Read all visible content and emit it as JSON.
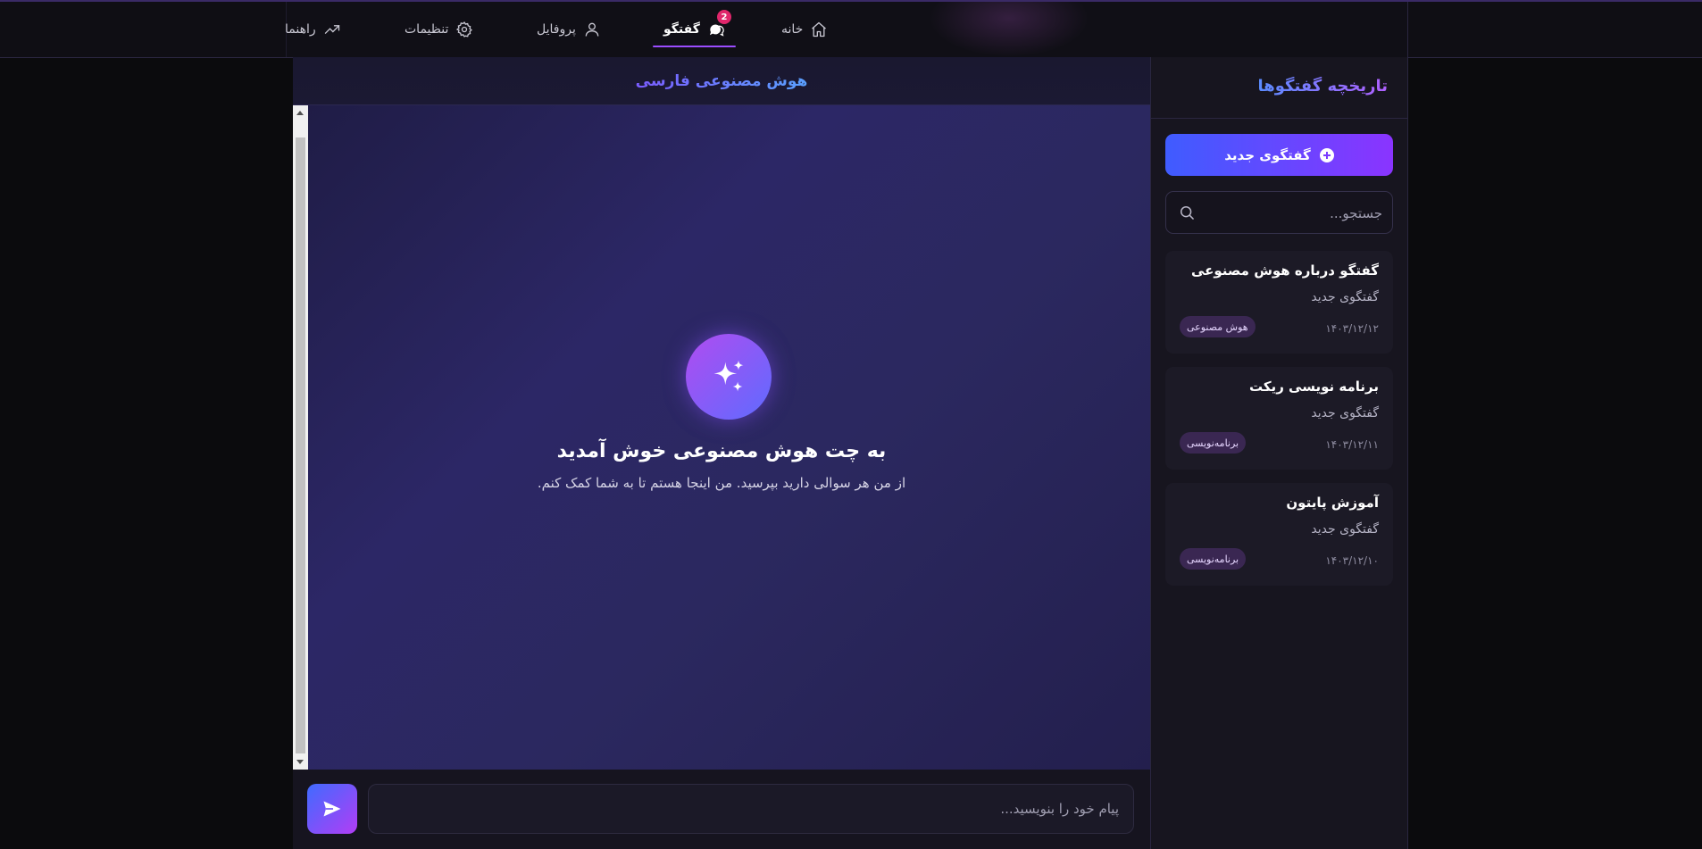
{
  "nav": {
    "items": [
      {
        "label": "خانه",
        "icon": "home-icon"
      },
      {
        "label": "گفتگو",
        "icon": "chat-icon",
        "badge": "2",
        "active": true
      },
      {
        "label": "پروفایل",
        "icon": "user-icon"
      },
      {
        "label": "تنظیمات",
        "icon": "gear-icon"
      },
      {
        "label": "راهنما",
        "icon": "trend-icon"
      }
    ]
  },
  "chat": {
    "header_title": "هوش مصنوعی فارسی",
    "welcome_title": "به چت هوش مصنوعی خوش آمدید",
    "welcome_subtitle": "از من هر سوالی دارید بپرسید. من اینجا هستم تا به شما کمک کنم.",
    "input_placeholder": "پیام خود را بنویسید..."
  },
  "sidebar": {
    "title": "تاریخچه گفتگوها",
    "new_chat_label": "گفتگوی جدید",
    "search_placeholder": "جستجو...",
    "conversations": [
      {
        "title": "گفتگو درباره هوش مصنوعی",
        "subtitle": "گفتگوی جدید",
        "date": "۱۴۰۳/۱۲/۱۲",
        "tag": "هوش مصنوعی"
      },
      {
        "title": "برنامه نویسی ریکت",
        "subtitle": "گفتگوی جدید",
        "date": "۱۴۰۳/۱۲/۱۱",
        "tag": "برنامه‌نویسی"
      },
      {
        "title": "آموزش پایتون",
        "subtitle": "گفتگوی جدید",
        "date": "۱۴۰۳/۱۲/۱۰",
        "tag": "برنامه‌نویسی"
      }
    ]
  },
  "colors": {
    "accent": "#9b4dff",
    "badge": "#e0266b",
    "background": "#0b0b0d"
  }
}
